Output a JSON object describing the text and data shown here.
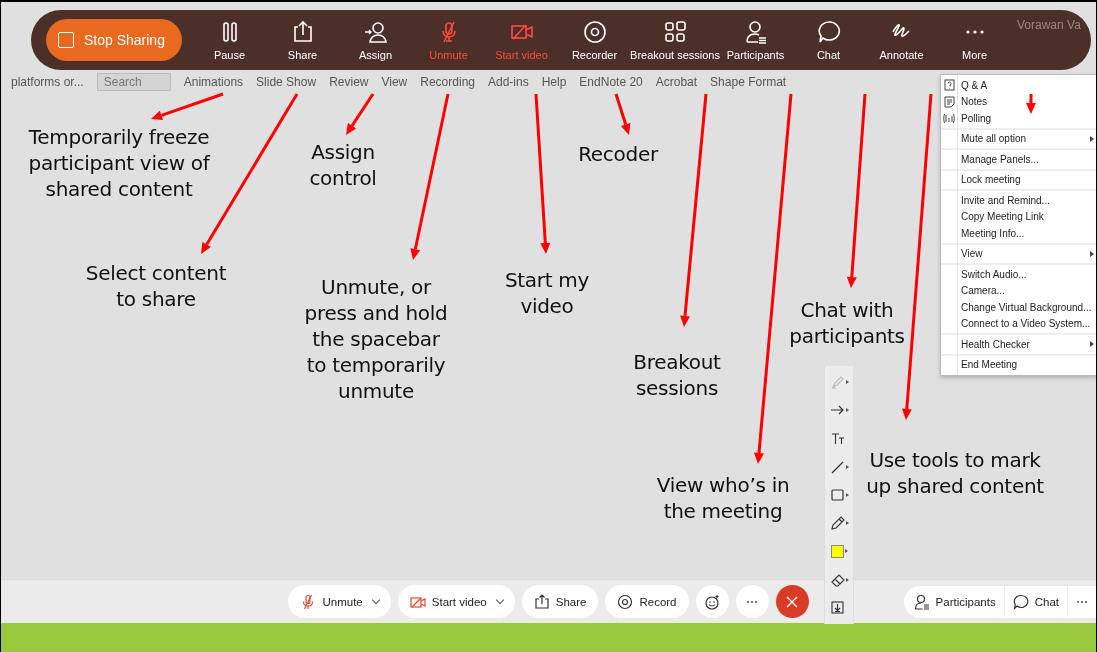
{
  "toolbar": {
    "stop_sharing": "Stop Sharing",
    "items": [
      {
        "kind": "pause",
        "label": "Pause",
        "off": false
      },
      {
        "kind": "share",
        "label": "Share",
        "off": false
      },
      {
        "kind": "assign",
        "label": "Assign",
        "off": false
      },
      {
        "kind": "mic",
        "label": "Unmute",
        "off": true
      },
      {
        "kind": "video",
        "label": "Start video",
        "off": true
      },
      {
        "kind": "recorder",
        "label": "Recorder",
        "off": false
      },
      {
        "kind": "breakout",
        "label": "Breakout sessions",
        "off": false
      },
      {
        "kind": "participants",
        "label": "Participants",
        "off": false
      },
      {
        "kind": "chat",
        "label": "Chat",
        "off": false
      },
      {
        "kind": "annotate",
        "label": "Annotate",
        "off": false
      },
      {
        "kind": "more",
        "label": "More",
        "off": false
      }
    ],
    "user_name": "Vorawan Va"
  },
  "ribbon": {
    "document_title": "platforms or...",
    "search": {
      "placeholder": "Search"
    },
    "tabs": [
      "Animations",
      "Slide Show",
      "Review",
      "View",
      "Recording",
      "Add-ins",
      "Help",
      "EndNote 20",
      "Acrobat",
      "Shape Format"
    ]
  },
  "callouts": [
    "Temporarily freeze\nparticipant view of\nshared content",
    "Select content\nto share",
    "Assign\ncontrol",
    "Unmute, or\npress and hold\nthe spacebar\nto temporarily\nunmute",
    "Start my\nvideo",
    "Recoder",
    "Breakout\nsessions",
    "View who’s in\nthe meeting",
    "Chat with\nparticipants",
    "Use tools to mark\nup shared content"
  ],
  "more_menu": {
    "sections": [
      [
        {
          "kind": "qa",
          "label": "Q & A",
          "submenu": false
        },
        {
          "kind": "notes",
          "label": "Notes",
          "submenu": false
        },
        {
          "kind": "polling",
          "label": "Polling",
          "submenu": false
        }
      ],
      [
        {
          "kind": "plain",
          "label": "Mute all option",
          "submenu": true
        }
      ],
      [
        {
          "kind": "plain",
          "label": "Manage Panels...",
          "submenu": false
        }
      ],
      [
        {
          "kind": "plain",
          "label": "Lock meeting",
          "submenu": false
        }
      ],
      [
        {
          "kind": "plain",
          "label": "Invite and Remind...",
          "submenu": false
        },
        {
          "kind": "plain",
          "label": "Copy Meeting Link",
          "submenu": false
        },
        {
          "kind": "plain",
          "label": "Meeting Info...",
          "submenu": false
        }
      ],
      [
        {
          "kind": "plain",
          "label": "View",
          "submenu": true
        }
      ],
      [
        {
          "kind": "plain",
          "label": "Switch Audio...",
          "submenu": false
        },
        {
          "kind": "plain",
          "label": "Camera...",
          "submenu": false
        },
        {
          "kind": "plain",
          "label": "Change Virtual Background...",
          "submenu": false
        },
        {
          "kind": "plain",
          "label": "Connect to a Video System...",
          "submenu": false
        }
      ],
      [
        {
          "kind": "plain",
          "label": "Health Checker",
          "submenu": true
        }
      ],
      [
        {
          "kind": "plain",
          "label": "End Meeting",
          "submenu": false
        }
      ]
    ]
  },
  "annotation_tools": [
    {
      "kind": "highlighter",
      "disabled": true,
      "submenu": true
    },
    {
      "kind": "arrow",
      "disabled": false,
      "submenu": true
    },
    {
      "kind": "text",
      "disabled": false,
      "submenu": false
    },
    {
      "kind": "line",
      "disabled": false,
      "submenu": true
    },
    {
      "kind": "rectangle",
      "disabled": false,
      "submenu": true
    },
    {
      "kind": "pencil",
      "disabled": false,
      "submenu": true
    },
    {
      "kind": "color",
      "disabled": false,
      "submenu": true,
      "color": "#ffff00"
    },
    {
      "kind": "eraser",
      "disabled": false,
      "submenu": true
    },
    {
      "kind": "save",
      "disabled": false,
      "submenu": false
    }
  ],
  "bottom_bar": {
    "controls": [
      {
        "kind": "mic",
        "label": "Unmute",
        "dropdown": true
      },
      {
        "kind": "video",
        "label": "Start video",
        "dropdown": true
      },
      {
        "kind": "share",
        "label": "Share",
        "dropdown": false
      },
      {
        "kind": "record",
        "label": "Record",
        "dropdown": false
      },
      {
        "kind": "reactions",
        "dropdown": false
      },
      {
        "kind": "more",
        "label": "⋯",
        "dropdown": false
      },
      {
        "kind": "end",
        "dropdown": false
      }
    ],
    "panels": [
      {
        "kind": "participants",
        "label": "Participants"
      },
      {
        "kind": "chat",
        "label": "Chat"
      },
      {
        "kind": "more",
        "label": "⋯"
      }
    ]
  }
}
